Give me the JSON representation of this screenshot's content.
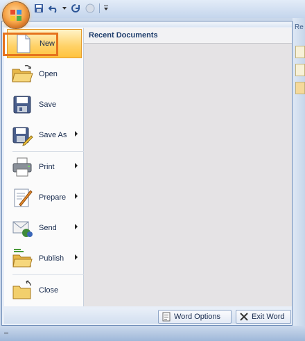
{
  "window": {
    "right_title_fragment": "Re"
  },
  "quick_access": {
    "items": [
      "save-icon",
      "undo-icon",
      "undo-dropdown-icon",
      "redo-icon",
      "disabled-icon",
      "customize-icon"
    ]
  },
  "menu": {
    "items": [
      {
        "label": "New",
        "icon": "new-document-icon",
        "submenu": false,
        "selected": true
      },
      {
        "label": "Open",
        "icon": "open-folder-icon",
        "submenu": false,
        "selected": false
      },
      {
        "label": "Save",
        "icon": "save-icon",
        "submenu": false,
        "selected": false
      },
      {
        "label": "Save As",
        "icon": "save-as-icon",
        "submenu": true,
        "selected": false
      },
      {
        "label": "Print",
        "icon": "printer-icon",
        "submenu": true,
        "selected": false
      },
      {
        "label": "Prepare",
        "icon": "prepare-icon",
        "submenu": true,
        "selected": false
      },
      {
        "label": "Send",
        "icon": "send-icon",
        "submenu": true,
        "selected": false
      },
      {
        "label": "Publish",
        "icon": "publish-icon",
        "submenu": true,
        "selected": false
      },
      {
        "label": "Close",
        "icon": "close-folder-icon",
        "submenu": false,
        "selected": false
      }
    ],
    "recent_title": "Recent Documents"
  },
  "bottom": {
    "options_label": "Word Options",
    "exit_label": "Exit Word"
  },
  "colors": {
    "accent": "#e5721d",
    "menu_border": "#6f8db8"
  }
}
